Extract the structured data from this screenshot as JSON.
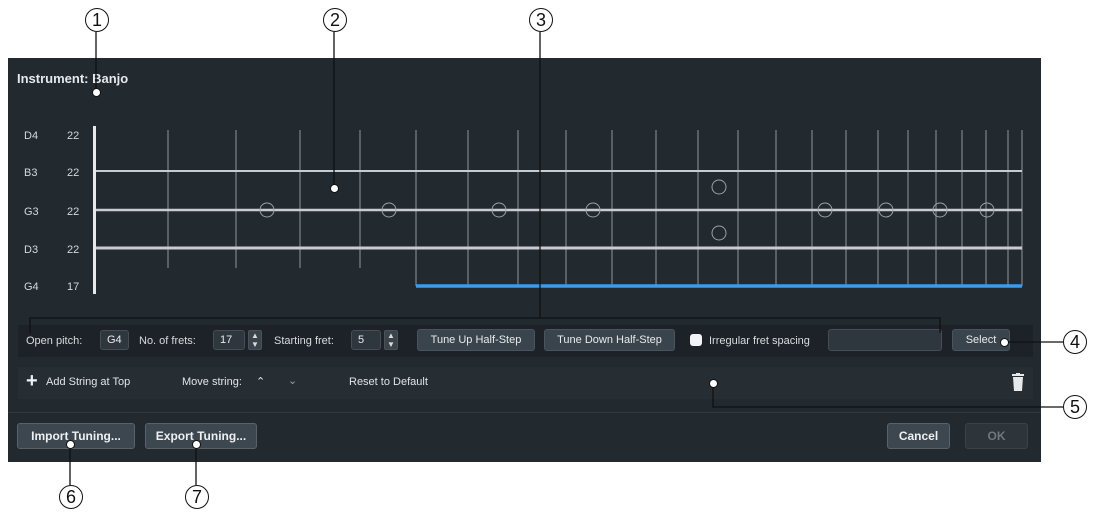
{
  "header": {
    "title": "Instrument: Banjo"
  },
  "strings": [
    {
      "name": "D4",
      "frets": "22"
    },
    {
      "name": "B3",
      "frets": "22"
    },
    {
      "name": "G3",
      "frets": "22"
    },
    {
      "name": "D3",
      "frets": "22"
    },
    {
      "name": "G4",
      "frets": "17"
    }
  ],
  "settings": {
    "open_pitch_label": "Open pitch:",
    "open_pitch_value": "G4",
    "num_frets_label": "No. of frets:",
    "num_frets_value": "17",
    "starting_fret_label": "Starting fret:",
    "starting_fret_value": "5",
    "tune_up": "Tune Up Half-Step",
    "tune_down": "Tune Down Half-Step",
    "irregular_label": "Irregular fret spacing",
    "irregular_value": "",
    "select_button": "Select"
  },
  "toolbar": {
    "add_string": "Add String at Top",
    "move_string_label": "Move string:",
    "reset": "Reset to Default"
  },
  "footer": {
    "import": "Import Tuning...",
    "export": "Export Tuning...",
    "cancel": "Cancel",
    "ok": "OK"
  },
  "callouts": [
    "1",
    "2",
    "3",
    "4",
    "5",
    "6",
    "7"
  ],
  "colors": {
    "dialog_bg": "#22292f",
    "selected_string": "#3d9be9",
    "string": "#c8ccd0"
  }
}
